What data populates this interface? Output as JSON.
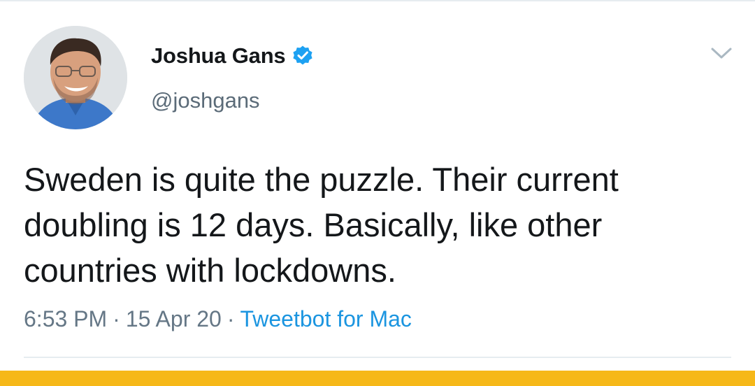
{
  "tweet": {
    "author": {
      "display_name": "Joshua Gans",
      "handle": "@joshgans",
      "verified": true,
      "verified_icon": "verified-badge-icon"
    },
    "text": "Sweden is quite the puzzle. Their current\ndoubling is 12 days. Basically, like other\ncountries with lockdowns.",
    "meta": {
      "time": "6:53 PM",
      "separator": "·",
      "date": "15 Apr 20",
      "source": "Tweetbot for Mac"
    },
    "menu_icon": "chevron-down-icon"
  },
  "colors": {
    "text": "#14171a",
    "secondary": "#657786",
    "link": "#1b95e0",
    "verified": "#1da1f2",
    "accent_bar": "#f6b818"
  }
}
